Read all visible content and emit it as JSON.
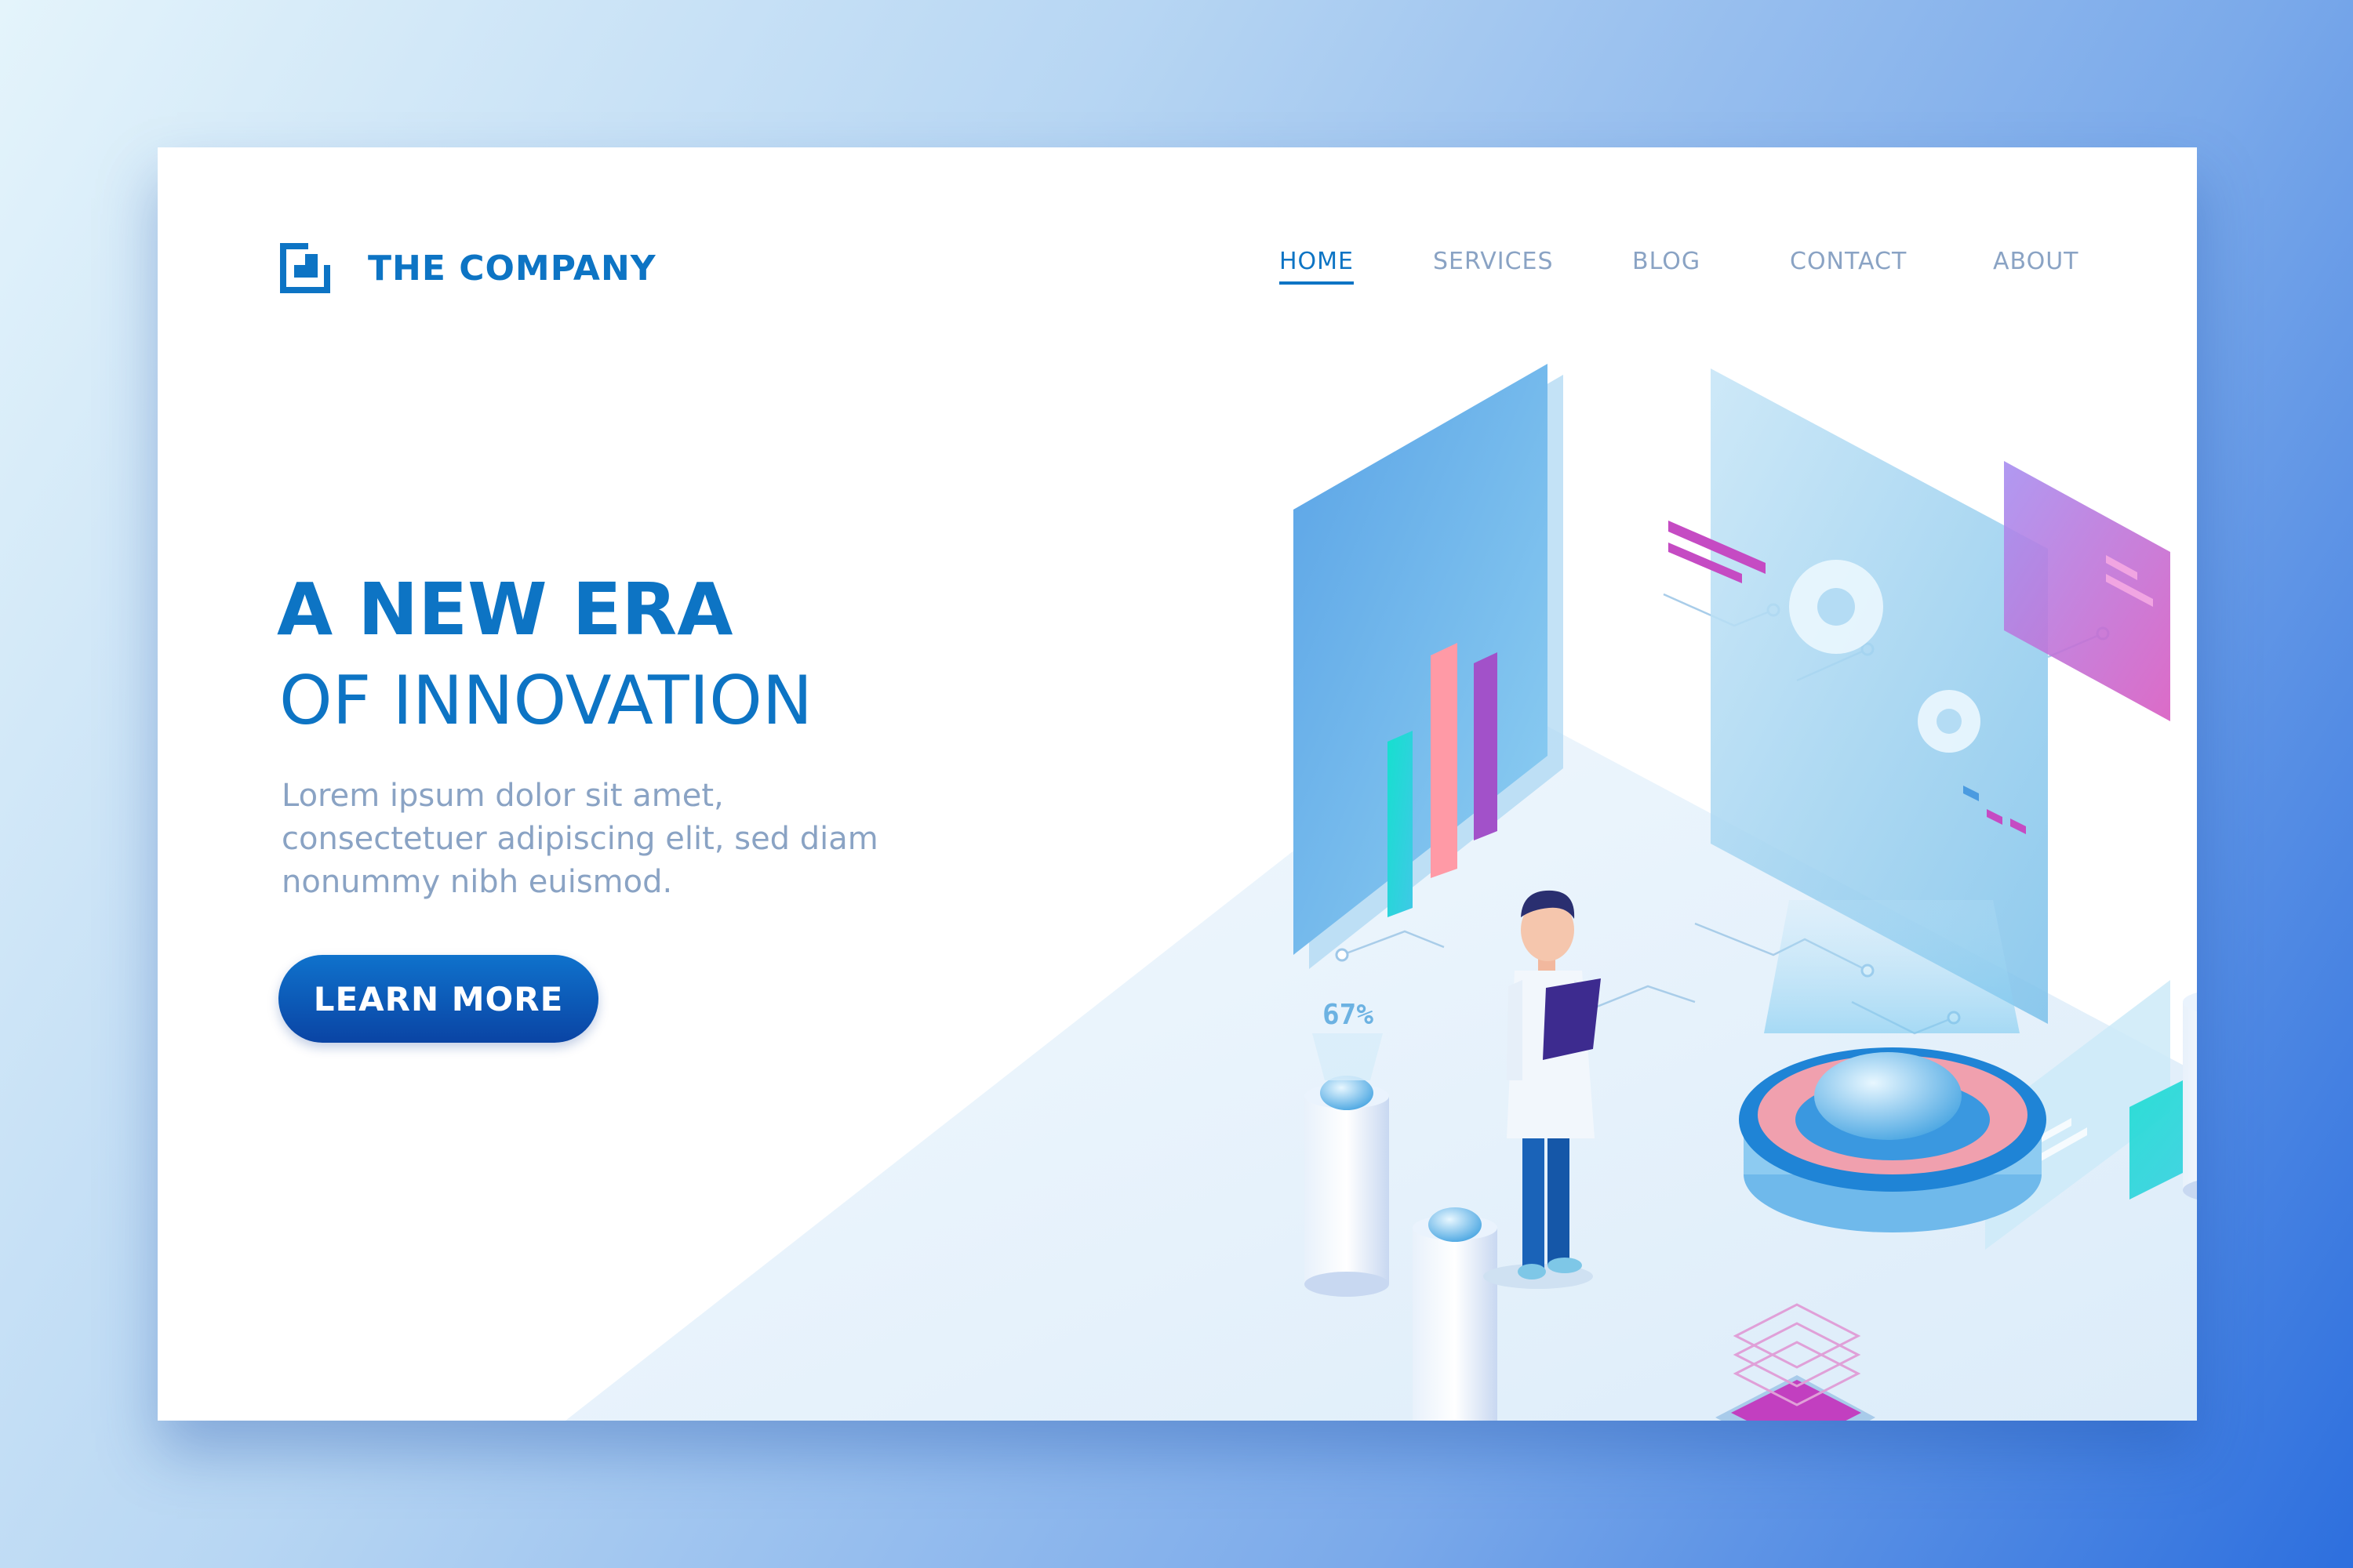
{
  "brand": {
    "name": "THE COMPANY",
    "logo_icon": "company-logo-icon"
  },
  "nav": {
    "items": [
      {
        "label": "HOME",
        "active": true
      },
      {
        "label": "SERVICES",
        "active": false
      },
      {
        "label": "BLOG",
        "active": false
      },
      {
        "label": "CONTACT",
        "active": false
      },
      {
        "label": "ABOUT",
        "active": false
      }
    ]
  },
  "hero": {
    "headline_line1": "A NEW ERA",
    "headline_line2": "OF INNOVATION",
    "description": "Lorem ipsum dolor sit amet, consectetuer adipiscing elit, sed diam nonummy nibh euismod.",
    "cta_label": "LEARN MORE"
  },
  "illustration": {
    "progress_label": "67%",
    "icons": [
      "bar-chart-panel",
      "gears-panel",
      "scientist-figure",
      "hologram-dome",
      "chip-icon"
    ]
  },
  "colors": {
    "accent": "#0d74c4",
    "muted_text": "#8aa3c4",
    "cta_top": "#0f72cc",
    "cta_bottom": "#0a44a4",
    "magenta": "#c54bc3",
    "teal": "#1fe0d0"
  }
}
